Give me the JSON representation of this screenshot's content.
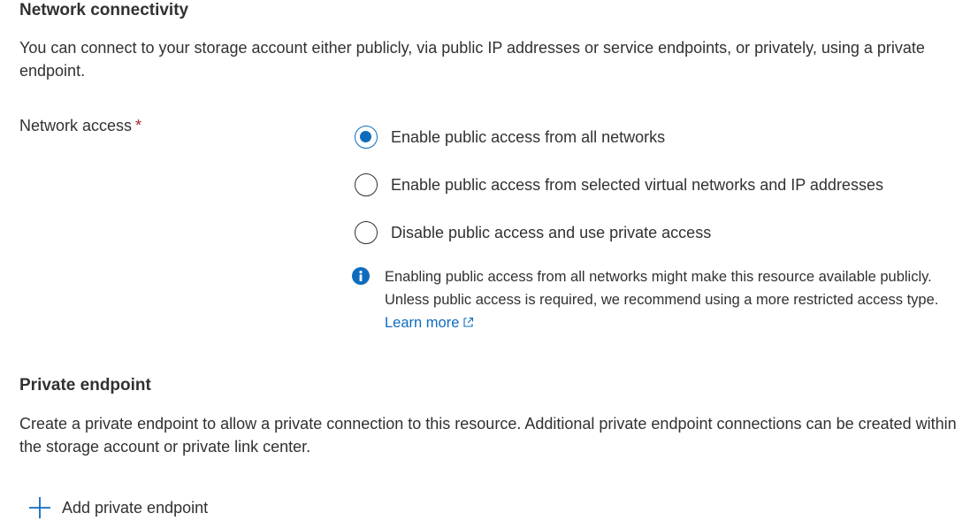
{
  "network_connectivity": {
    "title": "Network connectivity",
    "description": "You can connect to your storage account either publicly, via public IP addresses or service endpoints, or privately, using a private endpoint."
  },
  "network_access": {
    "label": "Network access",
    "required_marker": "*",
    "options": [
      {
        "label": "Enable public access from all networks",
        "checked": true
      },
      {
        "label": "Enable public access from selected virtual networks and IP addresses",
        "checked": false
      },
      {
        "label": "Disable public access and use private access",
        "checked": false
      }
    ],
    "info": {
      "icon": "info-icon",
      "text": "Enabling public access from all networks might make this resource available publicly. Unless public access is required, we recommend using a more restricted access type.",
      "link_label": "Learn more",
      "link_icon": "external-link-icon"
    }
  },
  "private_endpoint": {
    "title": "Private endpoint",
    "description": "Create a private endpoint to allow a private connection to this resource. Additional private endpoint connections can be created within the storage account or private link center.",
    "add_label": "Add private endpoint",
    "add_icon": "plus-icon"
  },
  "colors": {
    "accent": "#0f6cbd",
    "text": "#323130",
    "required": "#a4262c"
  }
}
